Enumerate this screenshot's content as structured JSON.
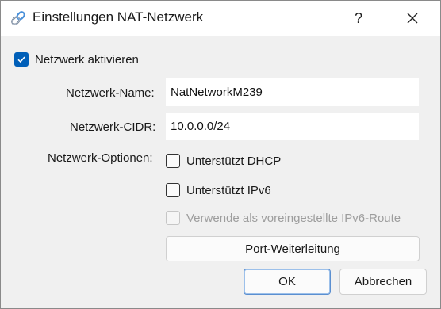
{
  "window": {
    "title": "Einstellungen NAT-Netzwerk",
    "icon": "link-chain-icon",
    "help_label": "?",
    "close_label": "✕"
  },
  "enable": {
    "label": "Netzwerk aktivieren",
    "checked": true
  },
  "fields": {
    "name_label": "Netzwerk-Name:",
    "name_value": "NatNetworkM239",
    "cidr_label": "Netzwerk-CIDR:",
    "cidr_value": "10.0.0.0/24"
  },
  "options": {
    "label": "Netzwerk-Optionen:",
    "dhcp_label": "Unterstützt DHCP",
    "dhcp_checked": false,
    "ipv6_label": "Unterstützt IPv6",
    "ipv6_checked": false,
    "ipv6_route_label": "Verwende als voreingestellte IPv6-Route",
    "ipv6_route_checked": false,
    "ipv6_route_enabled": false
  },
  "buttons": {
    "port_forwarding": "Port-Weiterleitung",
    "ok": "OK",
    "cancel": "Abbrechen"
  },
  "colors": {
    "accent": "#005fb8",
    "dialog_bg": "#f0f0f0",
    "disabled_text": "#9d9d9d"
  }
}
